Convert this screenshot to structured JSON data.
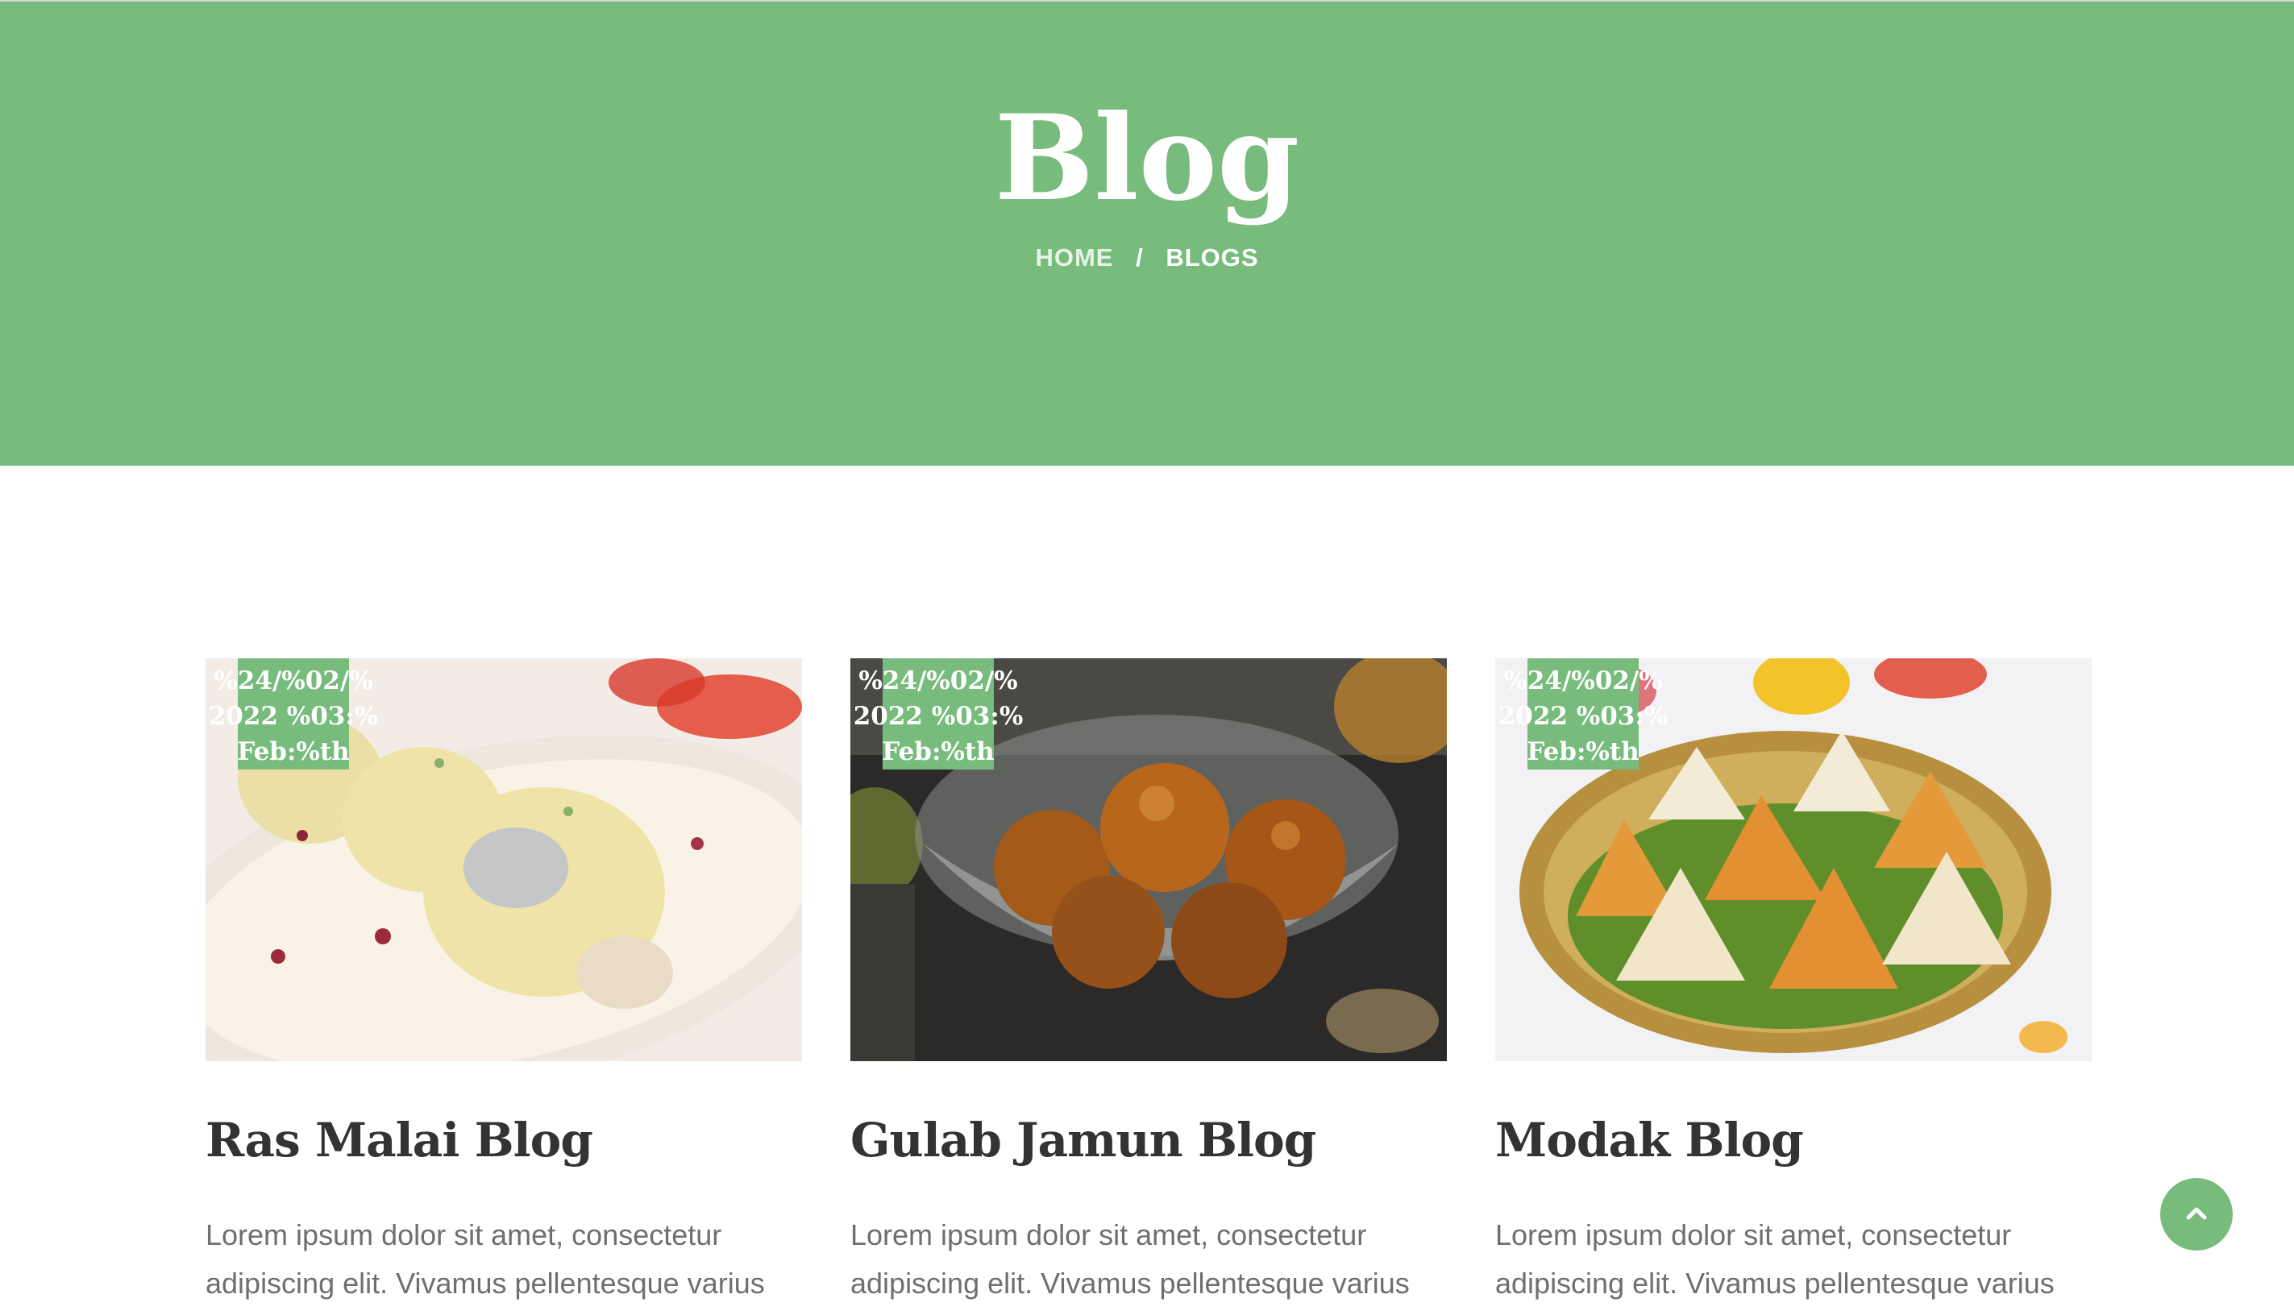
{
  "header": {
    "title": "Blog",
    "breadcrumb": {
      "home": "HOME",
      "separator": "/",
      "current": "BLOGS"
    }
  },
  "posts": [
    {
      "date": "%24/%02/%2022 %03:%Feb:%th",
      "title": "Ras Malai Blog",
      "excerpt": "Lorem ipsum dolor sit amet, consectetur adipiscing elit. Vivamus pellentesque varius"
    },
    {
      "date": "%24/%02/%2022 %03:%Feb:%th",
      "title": "Gulab Jamun Blog",
      "excerpt": "Lorem ipsum dolor sit amet, consectetur adipiscing elit. Vivamus pellentesque varius"
    },
    {
      "date": "%24/%02/%2022 %03:%Feb:%th",
      "title": "Modak Blog",
      "excerpt": "Lorem ipsum dolor sit amet, consectetur adipiscing elit. Vivamus pellentesque varius"
    }
  ],
  "scroll_top": {
    "icon": "chevron-up-icon"
  },
  "colors": {
    "accent": "#77bc7c",
    "title_text": "#333333",
    "body_text": "#6f6f6f"
  }
}
